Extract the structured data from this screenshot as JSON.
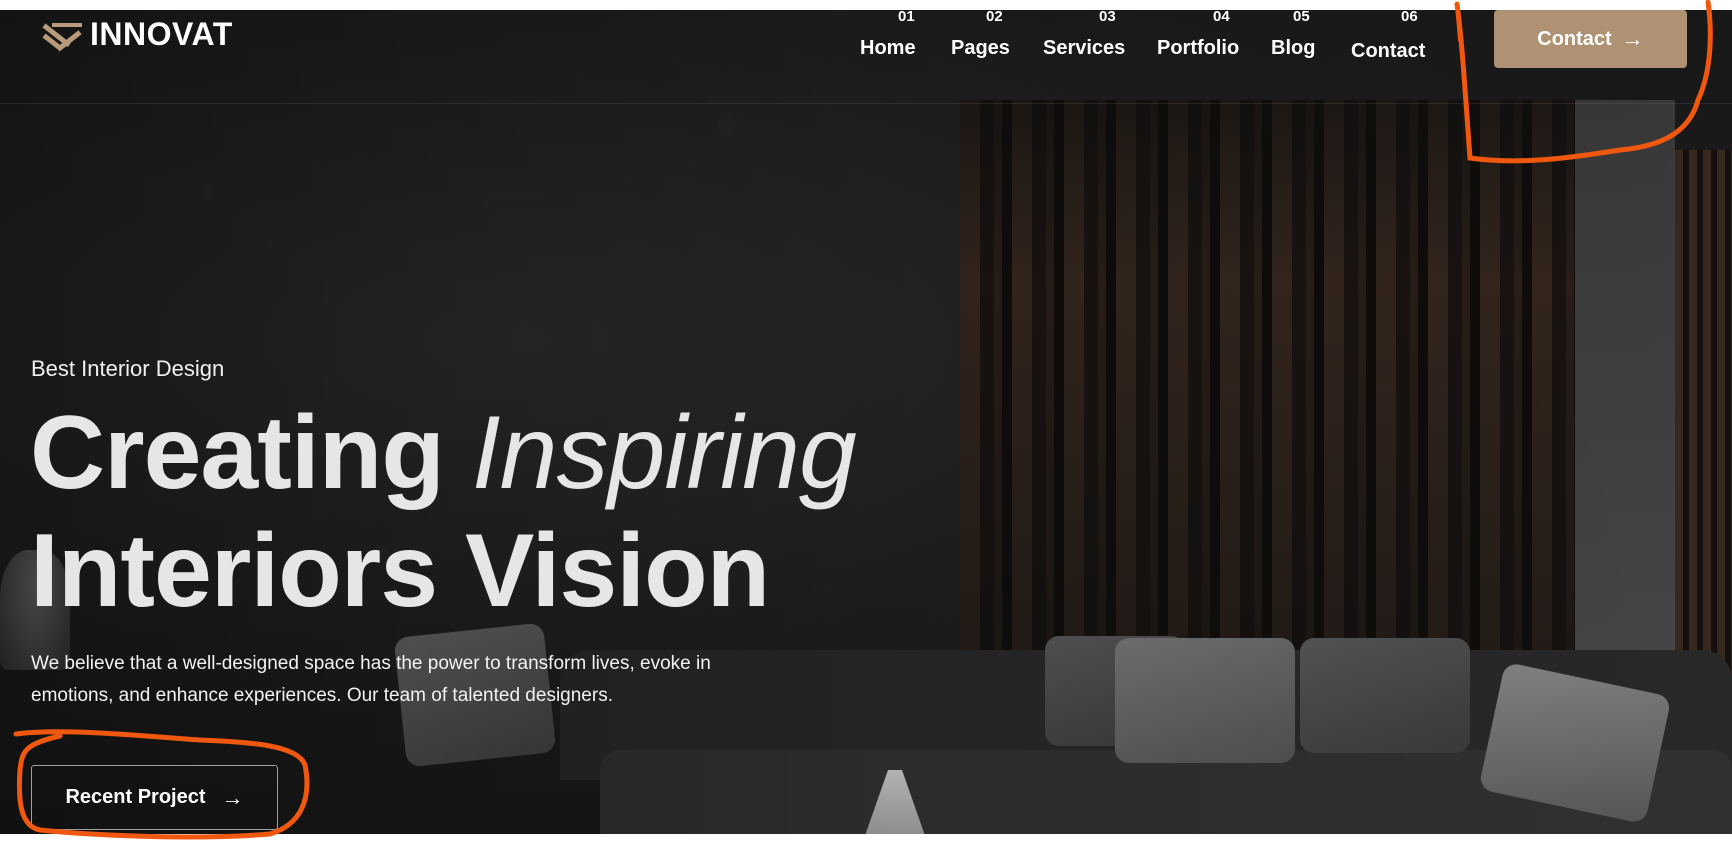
{
  "header": {
    "logo_text": "INNOVAT",
    "nav": [
      {
        "num": "01",
        "label": "Home"
      },
      {
        "num": "02",
        "label": "Pages"
      },
      {
        "num": "03",
        "label": "Services"
      },
      {
        "num": "04",
        "label": "Portfolio"
      },
      {
        "num": "05",
        "label": "Blog"
      },
      {
        "num": "06",
        "label": "Contact"
      }
    ],
    "contact_button": "Contact"
  },
  "hero": {
    "eyebrow": "Best Interior Design",
    "title_word1": "Creating",
    "title_italic": "Inspiring",
    "title_line2": "Interiors Vision",
    "description_line1": "We believe that a well-designed space has the power to transform lives, evoke in",
    "description_line2": "emotions, and enhance experiences. Our team of talented designers.",
    "cta_button": "Recent Project"
  },
  "colors": {
    "accent": "#ae9273",
    "annotation": "#f0580f"
  }
}
